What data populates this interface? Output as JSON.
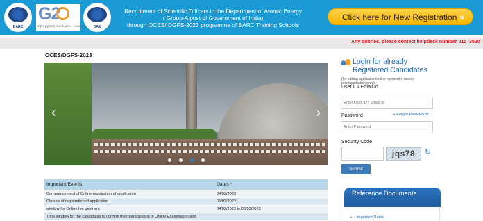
{
  "header": {
    "logo_left": "BARC",
    "logo_right": "DAE",
    "g20_sub": "वसुधैव कुटुम्बकम्  ONE EARTH · ONE FAMILY · ONE FUTURE",
    "line1": "Recruitment of Scientific Officers in the Department of Atomic Energy",
    "line2": "( Group-A post of Government of India)",
    "line3": "through OCES/ DGFS-2023 programme of BARC Training Schools",
    "register_button": "Click here for New Registration",
    "register_chevron": "»"
  },
  "marquee": {
    "text": "Any queries, please contact helpdesk number 011 -3500"
  },
  "page_title": "OCES/DGFS-2023",
  "carousel": {
    "prev": "‹",
    "next": "›",
    "slide_count": 4,
    "active_index": 2
  },
  "events": {
    "headers": [
      "Important Events",
      "Dates *"
    ],
    "rows": [
      [
        "Commencement of Online registration of application",
        "04/02/2023"
      ],
      [
        "Closure of registration of application",
        "05/03/2023"
      ],
      [
        "window for Online fee payment",
        "04/02/2023 to 06/03/2023"
      ],
      [
        "Time window for the candidates to confirm their participation in Online Examination and",
        ""
      ]
    ]
  },
  "login": {
    "title": "Login for already Registered Candidates",
    "note": "(for editing application/online payment/e-receipt print/application print)",
    "user_label": "User ID/ Email Id",
    "user_placeholder": "Enter User ID / Email Id",
    "password_label": "Password",
    "forgot_arrow": "»",
    "forgot": "Forgot Password?",
    "password_placeholder": "Enter Password",
    "security_label": "Security Code",
    "captcha": "jqs78",
    "refresh_icon": "↻",
    "submit": "Submit"
  },
  "reference": {
    "title": "Reference Documents",
    "arrow": "»",
    "item": ": Important Dates"
  },
  "colors": {
    "header_bg": "#1a9bd6",
    "register_btn": "#f7b500",
    "link_blue": "#2a6ebb",
    "alert_red": "#dd2222",
    "table_header": "#b6d7ea"
  }
}
